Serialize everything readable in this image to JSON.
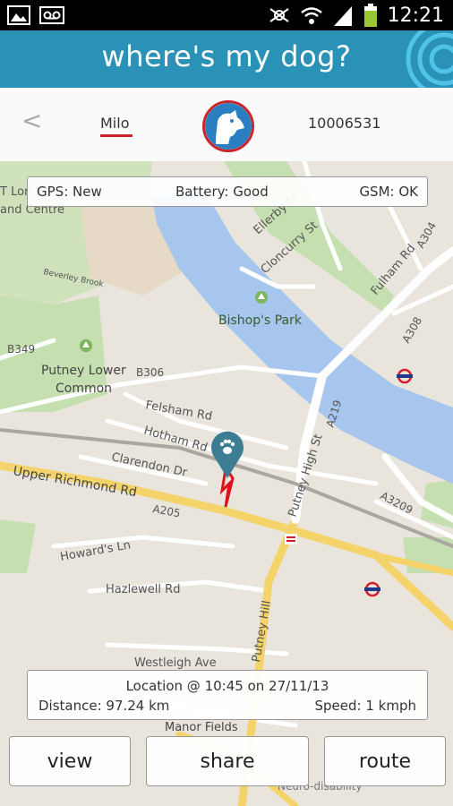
{
  "statusbar": {
    "time": "12:21",
    "icons": [
      "image-icon",
      "voicemail-icon",
      "mute-icon",
      "wifi-icon",
      "signal-icon",
      "battery-icon"
    ]
  },
  "header": {
    "title": "where's my dog?",
    "logo_icon": "target-logo-icon"
  },
  "dog": {
    "back_label": "<",
    "name": "Milo",
    "device_id": "10006531",
    "avatar_icon": "dog-head-icon"
  },
  "device_status": {
    "gps": "GPS: New",
    "battery": "Battery: Good",
    "gsm": "GSM: OK"
  },
  "location": {
    "line": "Location @ 10:45 on 27/11/13",
    "distance": "Distance: 97.24 km",
    "speed": "Speed: 1 kmph"
  },
  "map_labels": {
    "park": "Bishop's Park",
    "common1": "Putney Lower",
    "common2": "Common",
    "rd1": "Upper Richmond Rd",
    "a205": "A205",
    "felsham": "Felsham Rd",
    "hotham": "Hotham Rd",
    "clarendon": "Clarendon Dr",
    "howards": "Howard's Ln",
    "hazlewell": "Hazlewell Rd",
    "westleigh": "Westleigh Ave",
    "manor": "Manor Fields",
    "putneyhigh": "Putney High St",
    "putneyhill": "Putney Hill",
    "a219": "A219",
    "a3209": "A3209",
    "fulham": "Fulham Rd",
    "a304": "A304",
    "a308": "A308",
    "b349": "B349",
    "b306": "B306",
    "ellerby": "Ellerby St",
    "cloncurry": "Cloncurry St",
    "beverley": "Beverley Brook",
    "andcentre": "and Centre",
    "tlon": "T Lon",
    "neuro": "Neuro-disability"
  },
  "buttons": {
    "view": "view",
    "share": "share",
    "route": "route"
  },
  "colors": {
    "header": "#2a92b6",
    "accent": "#d0202a",
    "river": "#a6c6ee",
    "park": "#c6dfb0",
    "road_major": "#f5d36b"
  }
}
